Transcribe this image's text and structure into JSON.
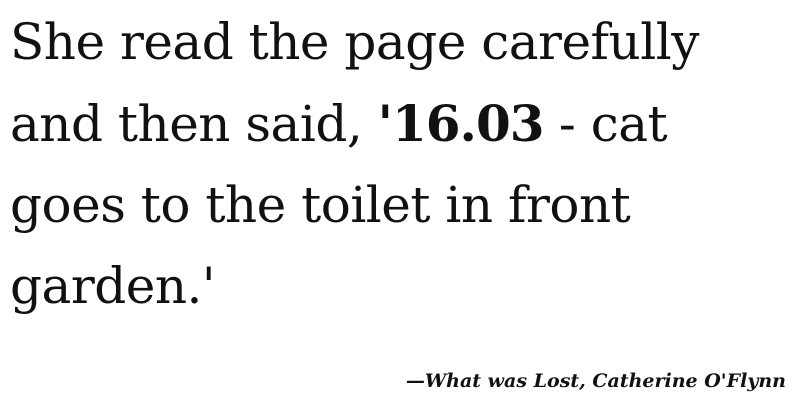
{
  "quote": {
    "line1": "She read the page carefully",
    "line2_start": "and then said, ",
    "emphasis": "'16.03",
    "line2_end": " - cat",
    "line3": "goes to the toilet in front",
    "line4": "garden.'"
  },
  "attribution": "—What was Lost, Catherine O'Flynn"
}
